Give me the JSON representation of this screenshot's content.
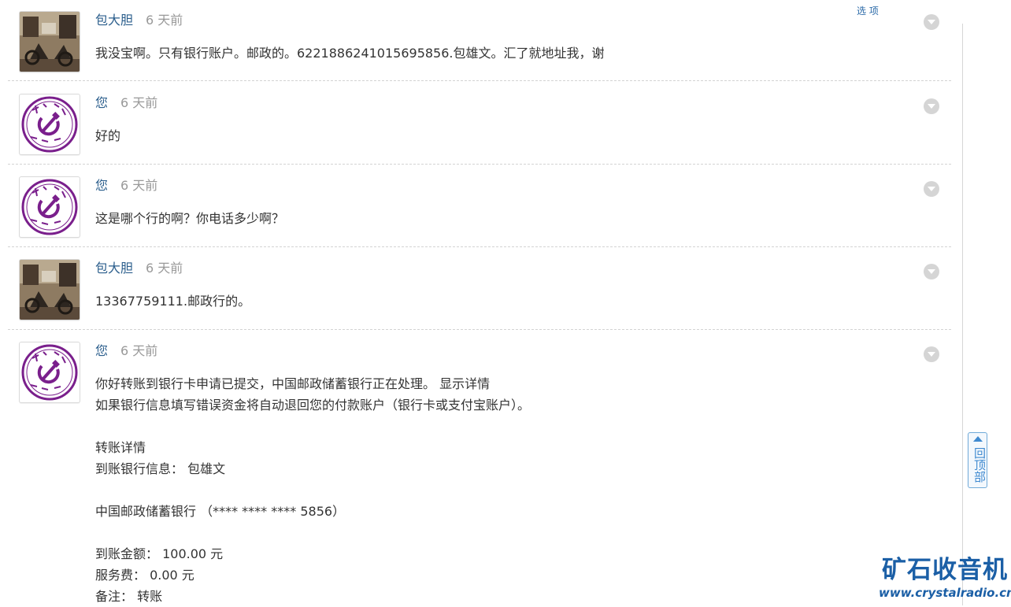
{
  "header": {
    "options_label": "选 项"
  },
  "messages": [
    {
      "author": "包大胆",
      "time": "6 天前",
      "avatar": "photo-avatar",
      "lines": [
        "我没宝啊。只有银行账户。邮政的。6221886241015695856.包雄文。汇了就地址我，谢"
      ]
    },
    {
      "author": "您",
      "time": "6 天前",
      "avatar": "seal-avatar",
      "lines": [
        "好的"
      ]
    },
    {
      "author": "您",
      "time": "6 天前",
      "avatar": "seal-avatar",
      "lines": [
        "这是哪个行的啊？你电话多少啊？"
      ]
    },
    {
      "author": "包大胆",
      "time": "6 天前",
      "avatar": "photo-avatar",
      "lines": [
        "13367759111.邮政行的。"
      ]
    },
    {
      "author": "您",
      "time": "6 天前",
      "avatar": "seal-avatar",
      "lines": [
        "你好转账到银行卡申请已提交，中国邮政储蓄银行正在处理。 显示详情",
        "如果银行信息填写错误资金将自动退回您的付款账户（银行卡或支付宝账户）。",
        "",
        "转账详情",
        "到账银行信息： 包雄文",
        "",
        "中国邮政储蓄银行 （**** **** **** 5856）",
        "",
        "到账金额： 100.00 元",
        "服务费： 0.00 元",
        "备注： 转账"
      ]
    }
  ],
  "back_to_top": {
    "label": "回顶部"
  },
  "watermark": {
    "name": "矿石收音机",
    "url": "www.crystalradio.cn"
  },
  "colors": {
    "author": "#2b5e8c",
    "time": "#999999",
    "accent": "#1b5fa6",
    "seal": "#7a1f8c"
  },
  "icons": {
    "message_menu": "chevron-down-circle-icon",
    "back_to_top": "up-arrow-icon"
  }
}
